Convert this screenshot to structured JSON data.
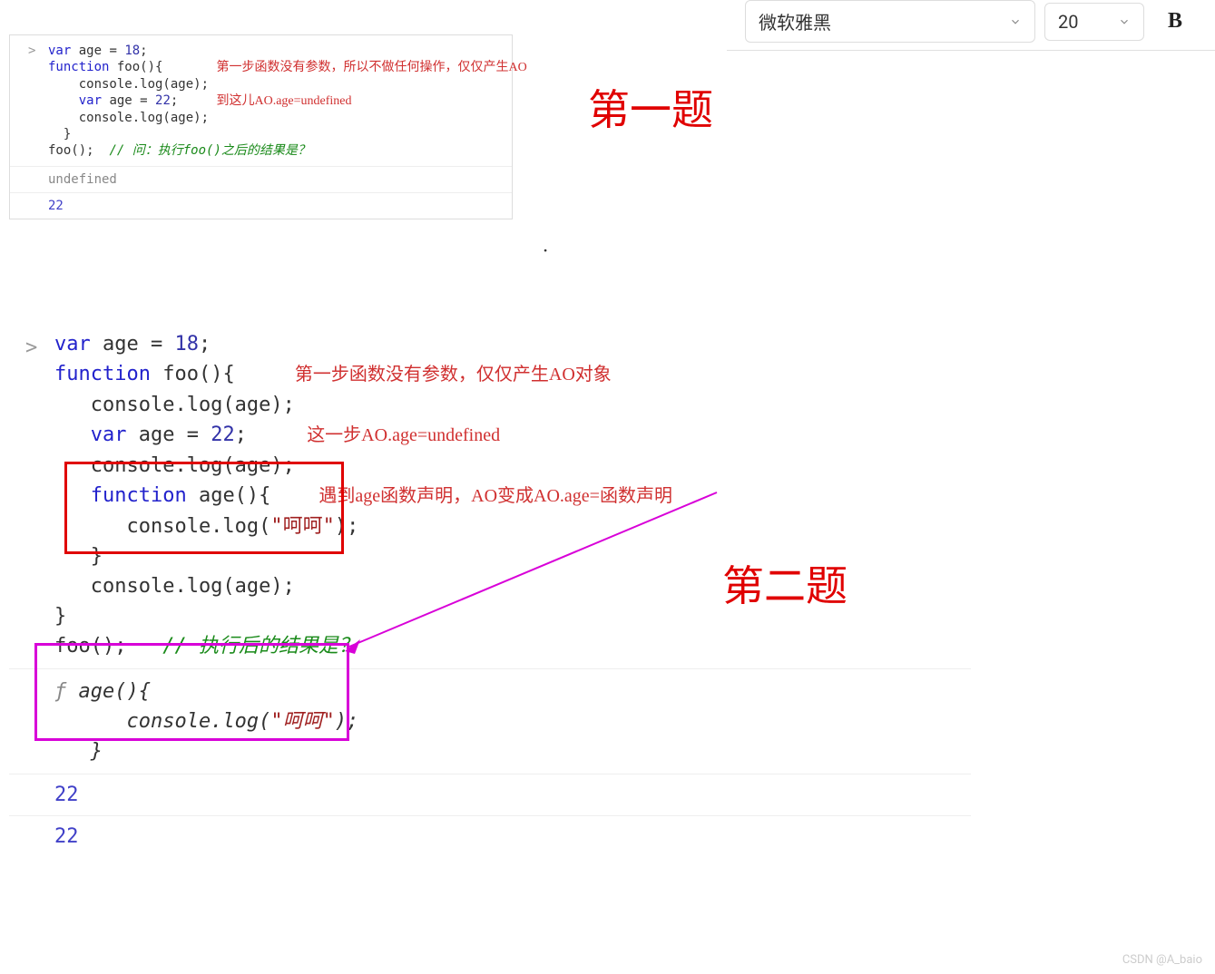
{
  "toolbar": {
    "font_name": "微软雅黑",
    "font_size": "20",
    "bold_label": "B"
  },
  "title1": "第一题",
  "title2": "第二题",
  "bullet": "·",
  "block1": {
    "prompt": ">",
    "line1_var": "var",
    "line1_rest": " age = ",
    "line1_num": "18",
    "line1_semi": ";",
    "line2_func": "function",
    "line2_rest": " foo(){",
    "line3": "    console.log(age);",
    "line3_anno": "第一步函数没有参数，所以不做任何操作，仅仅产生AO",
    "line4_var": "    var",
    "line4_rest": " age = ",
    "line4_num": "22",
    "line4_semi": ";",
    "line4_anno": "到这儿AO.age=undefined",
    "line5": "    console.log(age);",
    "line6": "  }",
    "line7": "foo();  ",
    "line7_comment": "// 问：执行foo()之后的结果是？",
    "out1": "undefined",
    "out2": "22"
  },
  "block2": {
    "prompt": ">",
    "l1_var": "var",
    "l1_ident": " age = ",
    "l1_num": "18",
    "l1_semi": ";",
    "l2_func": "function",
    "l2_rest": " foo(){",
    "l2_anno": "第一步函数没有参数，仅仅产生AO对象",
    "l3": "   console.log(age);",
    "l4_var": "   var",
    "l4_rest": " age = ",
    "l4_num": "22",
    "l4_semi": ";",
    "l4_anno": "这一步AO.age=undefined",
    "l5": "   console.log(age);",
    "l6_func": "   function",
    "l6_rest": " age(){",
    "l6_anno": "遇到age函数声明，AO变成AO.age=函数声明",
    "l7": "      console.log(",
    "l7_str": "\"呵呵\"",
    "l7_end": ");",
    "l8": "   }",
    "l9": "   console.log(age);",
    "l10": "}",
    "l11": "foo();   ",
    "l11_comment": "// 执行后的结果是？",
    "out_f": "ƒ",
    "out_sig": " age(){",
    "out_body": "      console.log(",
    "out_str": "\"呵呵\"",
    "out_body_end": ");",
    "out_close": "   }",
    "out_n1": "22",
    "out_n2": "22"
  },
  "watermark": "CSDN @A_baio"
}
